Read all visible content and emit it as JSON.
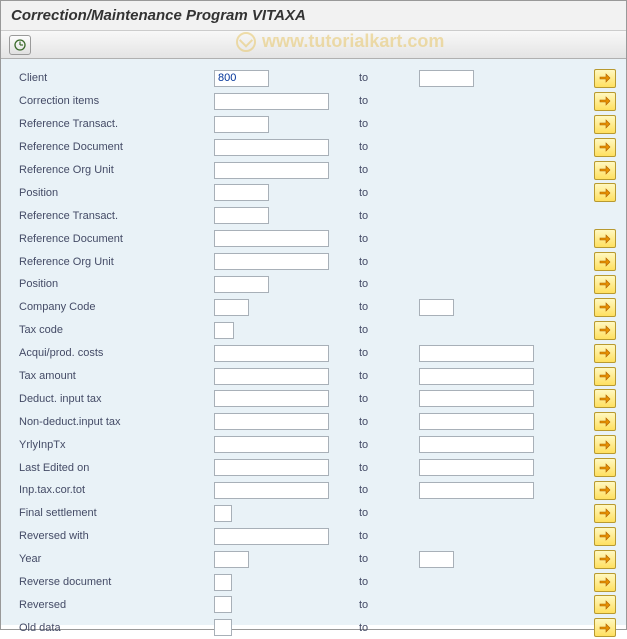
{
  "title": "Correction/Maintenance Program VITAXA",
  "watermark": "www.tutorialkart.com",
  "to_label": "to",
  "rows": [
    {
      "label": "Client",
      "from": "800",
      "to": "",
      "from_w": "w-sml",
      "to_w": "w-sml",
      "multi": true
    },
    {
      "label": "Correction items",
      "from": "",
      "to": "",
      "from_w": "w-med",
      "to_w": "",
      "multi": true
    },
    {
      "label": "Reference Transact.",
      "from": "",
      "to": "",
      "from_w": "w-sml",
      "to_w": "",
      "multi": true
    },
    {
      "label": "Reference Document",
      "from": "",
      "to": "",
      "from_w": "w-med",
      "to_w": "",
      "multi": true
    },
    {
      "label": "Reference Org Unit",
      "from": "",
      "to": "",
      "from_w": "w-med",
      "to_w": "",
      "multi": true
    },
    {
      "label": "Position",
      "from": "",
      "to": "",
      "from_w": "w-sml",
      "to_w": "",
      "multi": true
    },
    {
      "label": "Reference Transact.",
      "from": "",
      "to": "",
      "from_w": "w-sml",
      "to_w": "",
      "multi": false
    },
    {
      "label": "Reference Document",
      "from": "",
      "to": "",
      "from_w": "w-med",
      "to_w": "",
      "multi": true
    },
    {
      "label": "Reference Org Unit",
      "from": "",
      "to": "",
      "from_w": "w-med",
      "to_w": "",
      "multi": true
    },
    {
      "label": "Position",
      "from": "",
      "to": "",
      "from_w": "w-sml",
      "to_w": "",
      "multi": true
    },
    {
      "label": "Company Code",
      "from": "",
      "to": "",
      "from_w": "w-tiny",
      "to_w": "w-tiny",
      "multi": true
    },
    {
      "label": "Tax code",
      "from": "",
      "to": "",
      "from_w": "w-xs",
      "to_w": "",
      "multi": true
    },
    {
      "label": "Acqui/prod. costs",
      "from": "",
      "to": "",
      "from_w": "w-med",
      "to_w": "w-med",
      "multi": true
    },
    {
      "label": "Tax amount",
      "from": "",
      "to": "",
      "from_w": "w-med",
      "to_w": "w-med",
      "multi": true
    },
    {
      "label": "Deduct. input tax",
      "from": "",
      "to": "",
      "from_w": "w-med",
      "to_w": "w-med",
      "multi": true
    },
    {
      "label": "Non-deduct.input tax",
      "from": "",
      "to": "",
      "from_w": "w-med",
      "to_w": "w-med",
      "multi": true
    },
    {
      "label": "YrlyInpTx",
      "from": "",
      "to": "",
      "from_w": "w-med",
      "to_w": "w-med",
      "multi": true
    },
    {
      "label": "Last Edited on",
      "from": "",
      "to": "",
      "from_w": "w-med",
      "to_w": "w-med",
      "multi": true
    },
    {
      "label": "Inp.tax.cor.tot",
      "from": "",
      "to": "",
      "from_w": "w-med",
      "to_w": "w-med",
      "multi": true
    },
    {
      "label": "Final settlement",
      "from": "",
      "to": "",
      "from_w": "w-chk",
      "to_w": "",
      "multi": true
    },
    {
      "label": "Reversed with",
      "from": "",
      "to": "",
      "from_w": "w-med",
      "to_w": "",
      "multi": true
    },
    {
      "label": "Year",
      "from": "",
      "to": "",
      "from_w": "w-tiny",
      "to_w": "w-tiny",
      "multi": true
    },
    {
      "label": "Reverse document",
      "from": "",
      "to": "",
      "from_w": "w-chk",
      "to_w": "",
      "multi": true
    },
    {
      "label": "Reversed",
      "from": "",
      "to": "",
      "from_w": "w-chk",
      "to_w": "",
      "multi": true
    },
    {
      "label": "Old data",
      "from": "",
      "to": "",
      "from_w": "w-chk",
      "to_w": "",
      "multi": true
    }
  ]
}
